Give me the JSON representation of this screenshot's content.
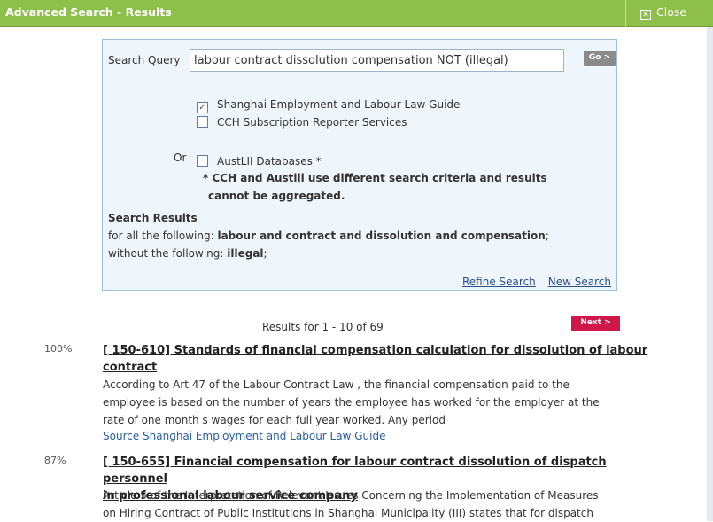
{
  "window": {
    "title": "Advanced Search - Results",
    "close_label": "Close"
  },
  "search": {
    "query_label": "Search Query",
    "query_value": "labour contract dissolution compensation NOT (illegal)",
    "go_label": "Go >",
    "databases": [
      {
        "label": "Shanghai Employment and Labour Law Guide",
        "checked": true
      },
      {
        "label": "CCH Subscription Reporter Services",
        "checked": false
      }
    ],
    "or_label": "Or",
    "austlii": {
      "label": "AustLII Databases *",
      "checked": false
    },
    "note_line1": "* CCH and Austlii use different search criteria and results",
    "note_line2": "cannot be aggregated.",
    "results_heading": "Search Results",
    "all_following_prefix": "for all the following: ",
    "all_following_terms": "labour and contract and dissolution and compensation",
    "all_following_suffix": ";",
    "without_prefix": "without the following: ",
    "without_terms": "illegal",
    "without_suffix": ";",
    "refine_label": "Refine Search",
    "new_label": "New Search"
  },
  "results": {
    "count_text": "Results for 1 - 10 of 69",
    "next_label": "Next >",
    "items": [
      {
        "score": "100%",
        "title_line1": "[ 150-610] Standards of financial compensation calculation for dissolution of labour",
        "title_line2": "contract",
        "snippet_line1": "According to Art 47 of the Labour Contract Law , the financial compensation paid to the",
        "snippet_line2": "employee is based on the number of years the employee has worked for the employer at the",
        "snippet_line3": "rate of one month s wages for each full year worked. Any period",
        "source": "Source Shanghai Employment and Labour Law Guide"
      },
      {
        "score": "87%",
        "title_line1": "[ 150-655] Financial compensation for labour contract dissolution of dispatch personnel",
        "title_line2": "in professional labour service company",
        "snippet_line1": "Article 5 of the Interpretation of Relevant Issues Concerning the Implementation of Measures",
        "snippet_line2": "on Hiring Contract of Public Institutions in Shanghai Municipality (III) states that for dispatch"
      }
    ]
  },
  "colors": {
    "titlebar": "#8fbf4b",
    "search_box_bg": "#eef6fb",
    "search_box_border": "#9ac2dc",
    "next_button": "#d0174a",
    "link": "#2a4f8b"
  }
}
